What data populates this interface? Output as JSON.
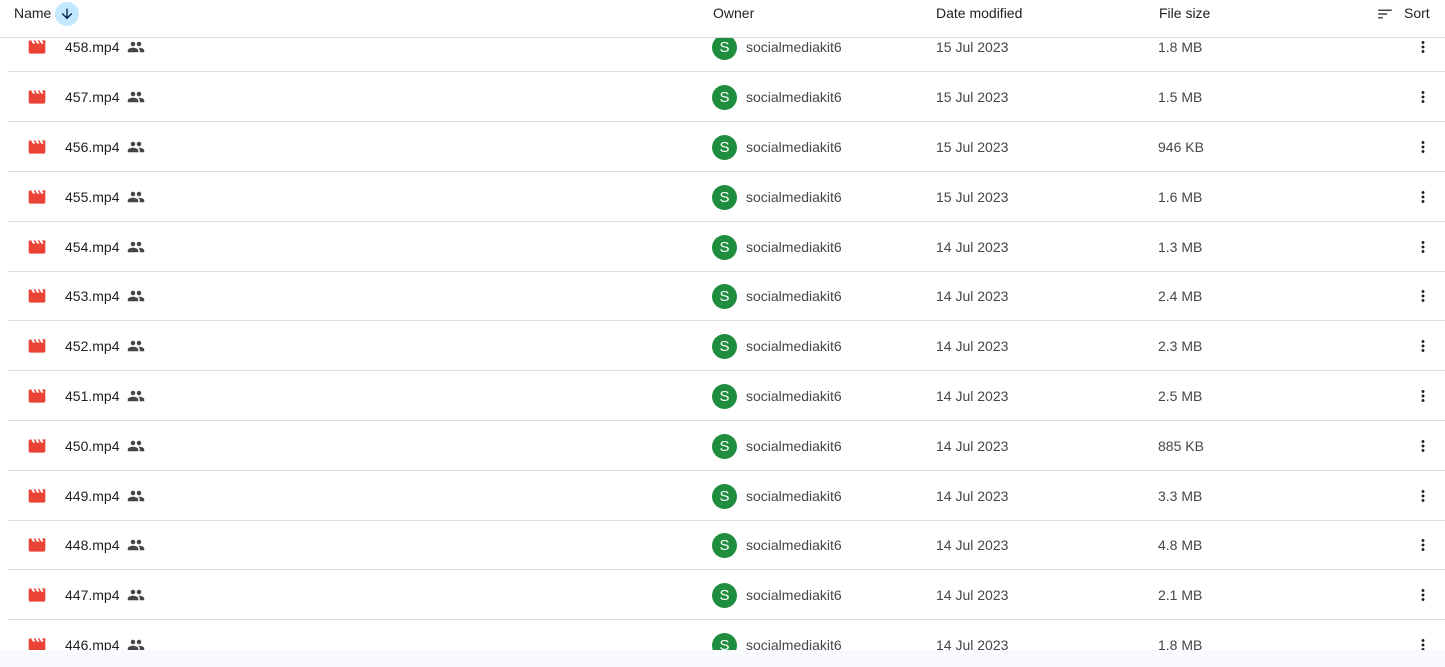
{
  "header": {
    "name_label": "Name",
    "owner_label": "Owner",
    "date_label": "Date modified",
    "size_label": "File size",
    "sort_label": "Sort"
  },
  "colors": {
    "file_icon": "#ea4335",
    "avatar_bg": "#1e8e3e",
    "sort_dir_bg": "#c2e7ff"
  },
  "files": [
    {
      "name": "458.mp4",
      "owner_initial": "S",
      "owner": "socialmediakit6",
      "date": "15 Jul 2023",
      "size": "1.8 MB"
    },
    {
      "name": "457.mp4",
      "owner_initial": "S",
      "owner": "socialmediakit6",
      "date": "15 Jul 2023",
      "size": "1.5 MB"
    },
    {
      "name": "456.mp4",
      "owner_initial": "S",
      "owner": "socialmediakit6",
      "date": "15 Jul 2023",
      "size": "946 KB"
    },
    {
      "name": "455.mp4",
      "owner_initial": "S",
      "owner": "socialmediakit6",
      "date": "15 Jul 2023",
      "size": "1.6 MB"
    },
    {
      "name": "454.mp4",
      "owner_initial": "S",
      "owner": "socialmediakit6",
      "date": "14 Jul 2023",
      "size": "1.3 MB"
    },
    {
      "name": "453.mp4",
      "owner_initial": "S",
      "owner": "socialmediakit6",
      "date": "14 Jul 2023",
      "size": "2.4 MB"
    },
    {
      "name": "452.mp4",
      "owner_initial": "S",
      "owner": "socialmediakit6",
      "date": "14 Jul 2023",
      "size": "2.3 MB"
    },
    {
      "name": "451.mp4",
      "owner_initial": "S",
      "owner": "socialmediakit6",
      "date": "14 Jul 2023",
      "size": "2.5 MB"
    },
    {
      "name": "450.mp4",
      "owner_initial": "S",
      "owner": "socialmediakit6",
      "date": "14 Jul 2023",
      "size": "885 KB"
    },
    {
      "name": "449.mp4",
      "owner_initial": "S",
      "owner": "socialmediakit6",
      "date": "14 Jul 2023",
      "size": "3.3 MB"
    },
    {
      "name": "448.mp4",
      "owner_initial": "S",
      "owner": "socialmediakit6",
      "date": "14 Jul 2023",
      "size": "4.8 MB"
    },
    {
      "name": "447.mp4",
      "owner_initial": "S",
      "owner": "socialmediakit6",
      "date": "14 Jul 2023",
      "size": "2.1 MB"
    },
    {
      "name": "446.mp4",
      "owner_initial": "S",
      "owner": "socialmediakit6",
      "date": "14 Jul 2023",
      "size": "1.8 MB"
    }
  ]
}
